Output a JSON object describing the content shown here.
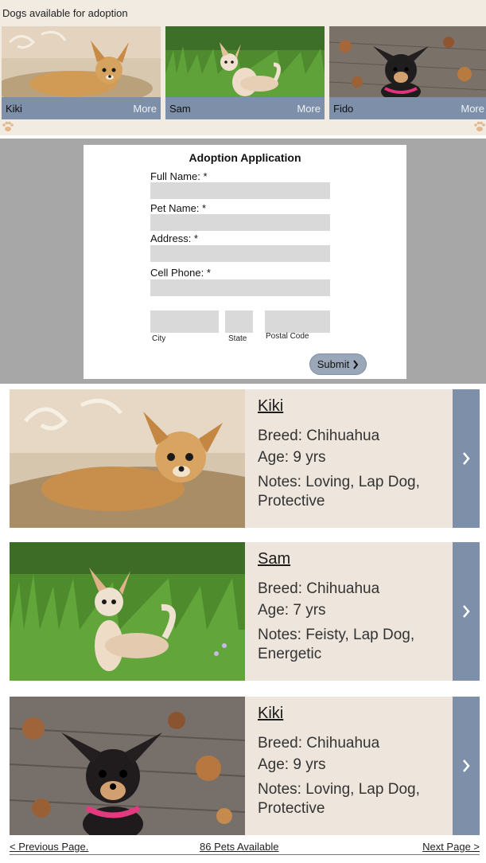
{
  "carousel": {
    "title": "Dogs available for adoption",
    "cards": [
      {
        "name": "Kiki",
        "more": "More"
      },
      {
        "name": "Sam",
        "more": "More"
      },
      {
        "name": "Fido",
        "more": "More"
      }
    ]
  },
  "form": {
    "title": "Adoption Application",
    "full_name_label": "Full Name: *",
    "pet_name_label": "Pet Name: *",
    "address_label": "Address: *",
    "cell_phone_label": "Cell Phone: *",
    "city_label": "City",
    "state_label": "State",
    "postal_label": "Postal Code",
    "submit_label": "Submit"
  },
  "dogs": [
    {
      "name": "Kiki",
      "breed": "Breed: Chihuahua",
      "age": "Age: 9 yrs",
      "notes": "Notes: Loving, Lap Dog, Protective"
    },
    {
      "name": "Sam",
      "breed": "Breed: Chihuahua",
      "age": "Age: 7 yrs",
      "notes": "Notes: Feisty, Lap Dog, Energetic"
    },
    {
      "name": "Kiki",
      "breed": "Breed: Chihuahua",
      "age": "Age: 9 yrs",
      "notes": "Notes: Loving, Lap Dog, Protective"
    }
  ],
  "footer": {
    "prev": "< Previous Page.",
    "count": "86 Pets Available",
    "next": "Next Page >"
  },
  "colors": {
    "beige": "#f1ebe1",
    "slate_blue": "#7d8fa9",
    "gray_backdrop": "#a7a7a7",
    "input_gray": "#d9d9d9"
  }
}
